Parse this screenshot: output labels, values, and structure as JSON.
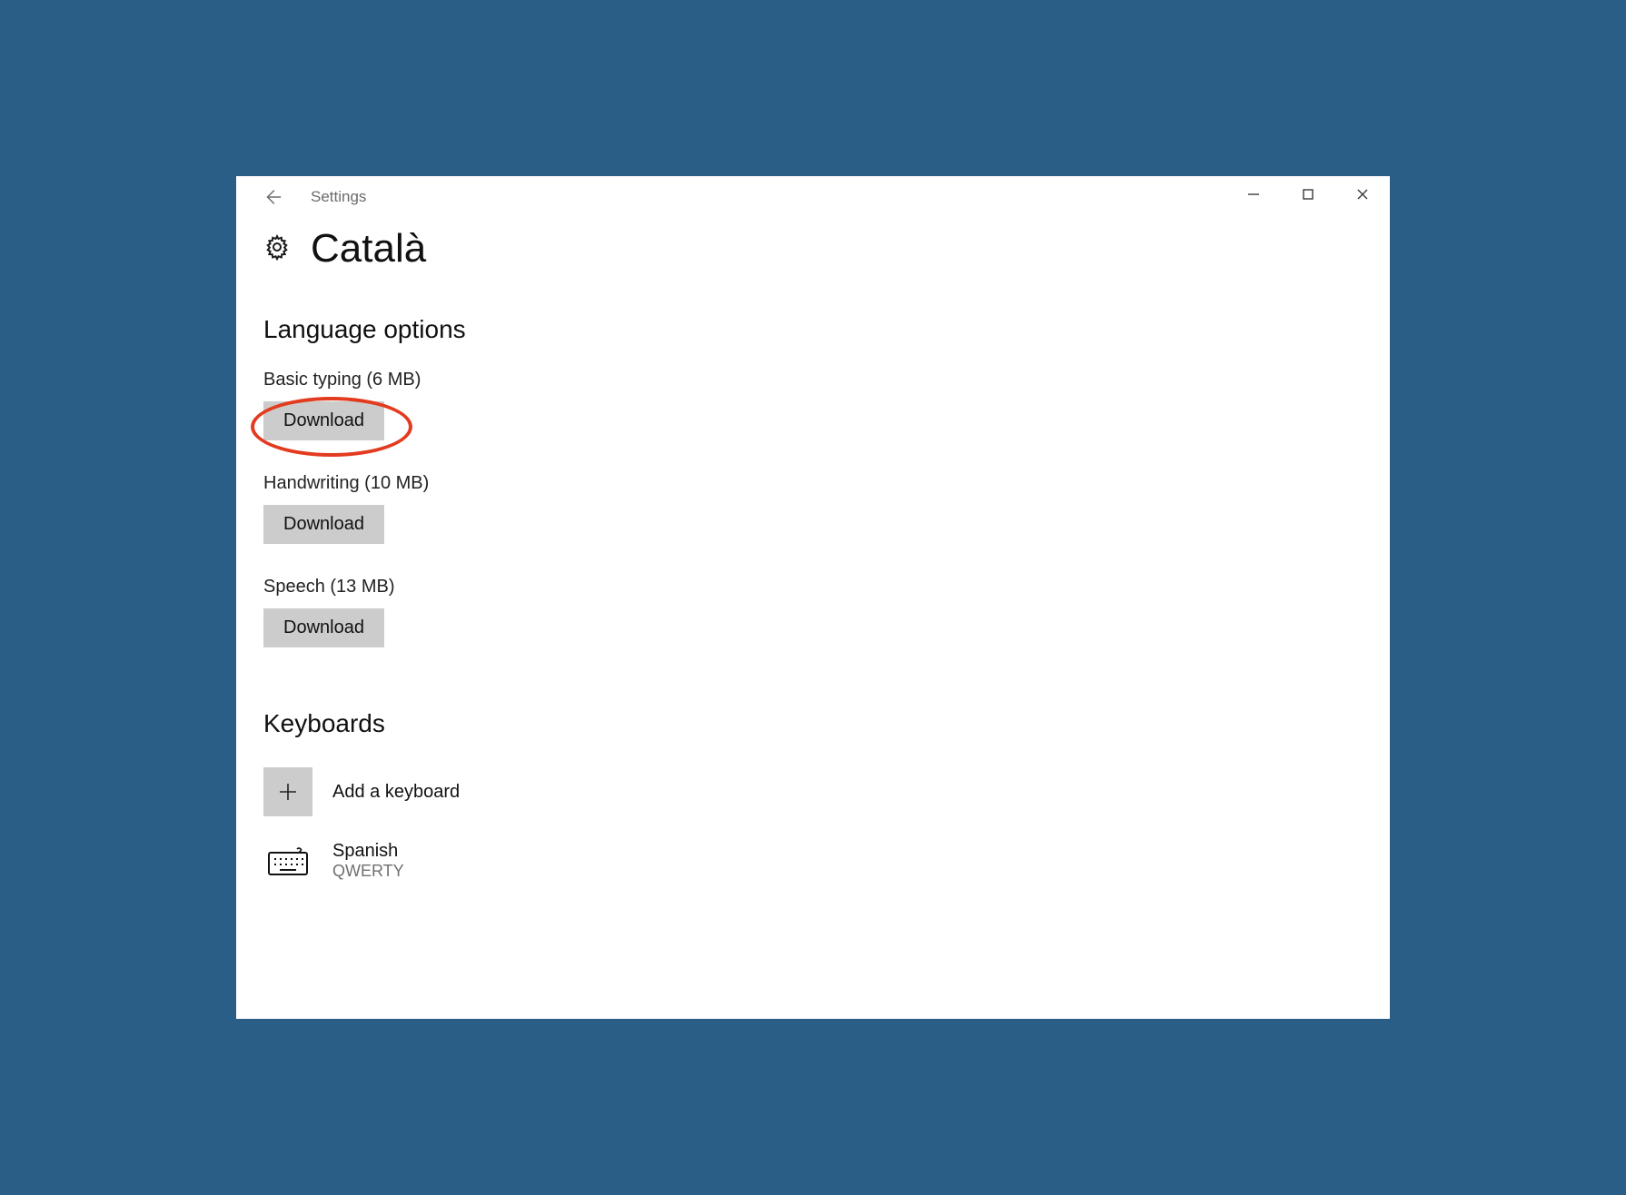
{
  "window": {
    "app_title": "Settings"
  },
  "page": {
    "title": "Català"
  },
  "language_options": {
    "heading": "Language options",
    "items": [
      {
        "label": "Basic typing (6 MB)",
        "button": "Download",
        "highlighted": true
      },
      {
        "label": "Handwriting (10 MB)",
        "button": "Download",
        "highlighted": false
      },
      {
        "label": "Speech (13 MB)",
        "button": "Download",
        "highlighted": false
      }
    ]
  },
  "keyboards": {
    "heading": "Keyboards",
    "add_label": "Add a keyboard",
    "items": [
      {
        "name": "Spanish",
        "layout": "QWERTY"
      }
    ]
  }
}
